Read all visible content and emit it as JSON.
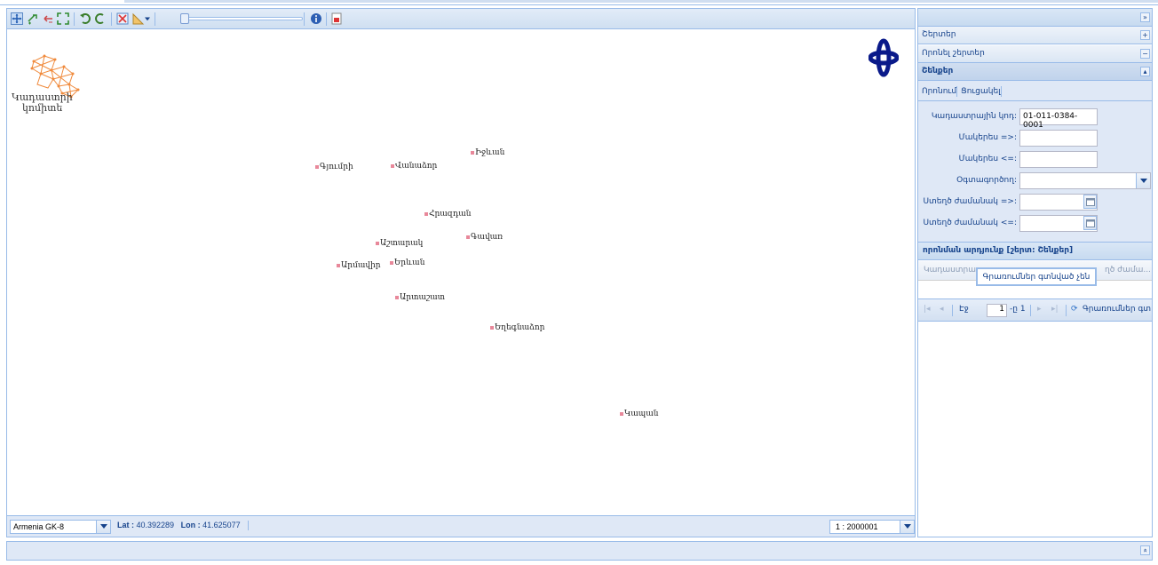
{
  "map": {
    "logo_text_line1": "Կադաստրի",
    "logo_text_line2": "կոմիտե",
    "cities": [
      {
        "name": "Գյումրի"
      },
      {
        "name": "Վանաձոր"
      },
      {
        "name": "Իջևան"
      },
      {
        "name": "Հրազդան"
      },
      {
        "name": "Գավառ"
      },
      {
        "name": "Աշտարակ"
      },
      {
        "name": "Արմավիր"
      },
      {
        "name": "Երևան"
      },
      {
        "name": "Արտաշատ"
      },
      {
        "name": "Եղեգնաձոր"
      },
      {
        "name": "Կապան"
      }
    ]
  },
  "status": {
    "projection": "Armenia GK-8",
    "lat_label": "Lat :",
    "lat_value": "40.392289",
    "lon_label": "Lon :",
    "lon_value": "41.625077",
    "scale": "1 : 2000001"
  },
  "panel": {
    "collapse_symbol": "»",
    "accordion": [
      {
        "label": "Շերտեր",
        "symbol": "+"
      },
      {
        "label": "Որոնել շերտեր",
        "symbol": "−"
      },
      {
        "label": "Շենքեր",
        "symbol": "▴"
      }
    ],
    "tabs": [
      "Որոնում",
      "Ցուցակել"
    ],
    "form": {
      "cadastral_code_label": "Կադաստրային կոդ:",
      "cadastral_code_value": "01-011-0384-0001",
      "area_from_label": "Մակերես =>:",
      "area_to_label": "Մակերես <=:",
      "user_label": "Օգտագործող:",
      "created_from_label": "Ստեղծ ժամանակ =>:",
      "created_to_label": "Ստեղծ ժամանակ <=:"
    },
    "results_title": "որոնման արդյունք [շերտ: Շենքեր]",
    "grid_columns": [
      "Կադաստրա",
      "ղծ ժամա..."
    ],
    "empty_message": "Գրառումներ գտնված չեն",
    "pager": {
      "page_label": "Էջ",
      "page_value": "1",
      "of_label": "-ը 1",
      "refresh_label": "Գրառումներ գտ"
    }
  },
  "bottom": {
    "expand_symbol": "»"
  },
  "colors": {
    "panel_bg": "#dfe8f6",
    "border": "#99bbe8",
    "text": "#15428b",
    "city_marker": "#e8889a"
  }
}
